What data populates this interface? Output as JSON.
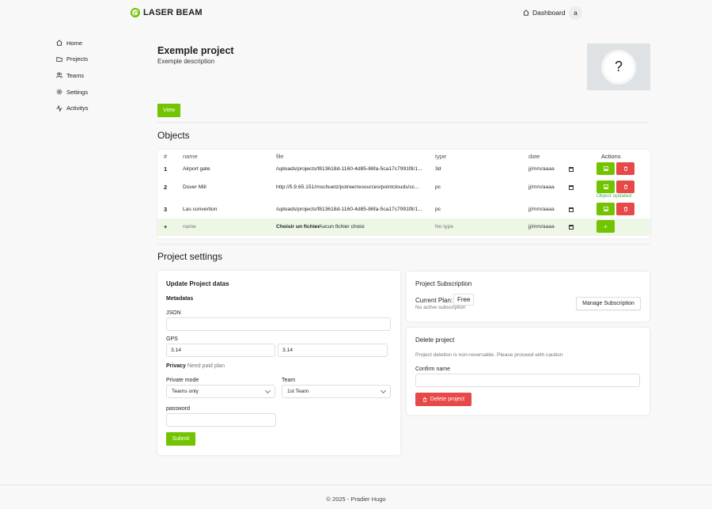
{
  "app": {
    "brand": "LASER BEAM",
    "dashboard_label": "Dashboard",
    "avatar_initial": "a",
    "accent": "#72c400",
    "danger": "#e74848"
  },
  "sidebar": {
    "items": [
      {
        "label": "Home",
        "icon": "home-icon"
      },
      {
        "label": "Projects",
        "icon": "folder-icon"
      },
      {
        "label": "Teams",
        "icon": "users-icon"
      },
      {
        "label": "Settings",
        "icon": "gear-icon"
      },
      {
        "label": "Activitys",
        "icon": "activity-icon"
      }
    ]
  },
  "project": {
    "title": "Exemple project",
    "description": "Exemple description",
    "image_placeholder": "?",
    "view_label": "View"
  },
  "objects": {
    "title": "Objects",
    "headers": {
      "num": "#",
      "name": "name",
      "file": "file",
      "type": "type",
      "date": "date",
      "actions": "Actions"
    },
    "rows": [
      {
        "num": "1",
        "name": "Airport gate",
        "file": "/uploads/projects/f813618d-1160-4d85-86fa-5ca17c7991f8/1...",
        "type": "3d",
        "date": "jj/mm/aaaa"
      },
      {
        "num": "2",
        "name": "Dover Mill",
        "file": "http://5.9.65.151/mschuetz/potree/resources/pointclouds/sc...",
        "type": "pc",
        "date": "jj/mm/aaaa",
        "status": "Object updated"
      },
      {
        "num": "3",
        "name": "Las convertion",
        "file": "/uploads/projects/f813618d-1160-4d85-86fa-5ca17c7991f8/1...",
        "type": "pc",
        "date": "jj/mm/aaaa"
      }
    ],
    "new_row": {
      "num": "+",
      "name_placeholder": "name",
      "file_button": "Choisir un fichier",
      "file_status": "Aucun fichier choisi",
      "type_placeholder": "No type",
      "date": "jj/mm/aaaa",
      "add_label": "+"
    }
  },
  "settings": {
    "title": "Project settings",
    "update": {
      "title": "Update Project datas",
      "metadatas": "Metadatas",
      "json_label": "JSON",
      "json_value": "",
      "gps_label": "GPS",
      "gps_lat": "3.14",
      "gps_lon": "3.14",
      "privacy_label": "Privacy",
      "privacy_note": "Need paid plan",
      "private_mode_label": "Private mode",
      "private_mode_value": "Teams only",
      "team_label": "Team",
      "team_value": "1st Team",
      "password_label": "password",
      "password_value": "",
      "submit_label": "Submit"
    },
    "subscription": {
      "title": "Project Subscription",
      "current_plan_label": "Current Plan:",
      "plan": "Free",
      "note": "No active subscription",
      "manage_label": "Manage Subscription"
    },
    "delete": {
      "title": "Delete project",
      "warning": "Project deletion is non-reversable. Please proceed with caution",
      "confirm_label": "Confirm name",
      "confirm_value": "",
      "button_label": "Delete project"
    }
  },
  "footer": {
    "text": "© 2025 - Pradier Hugo"
  }
}
